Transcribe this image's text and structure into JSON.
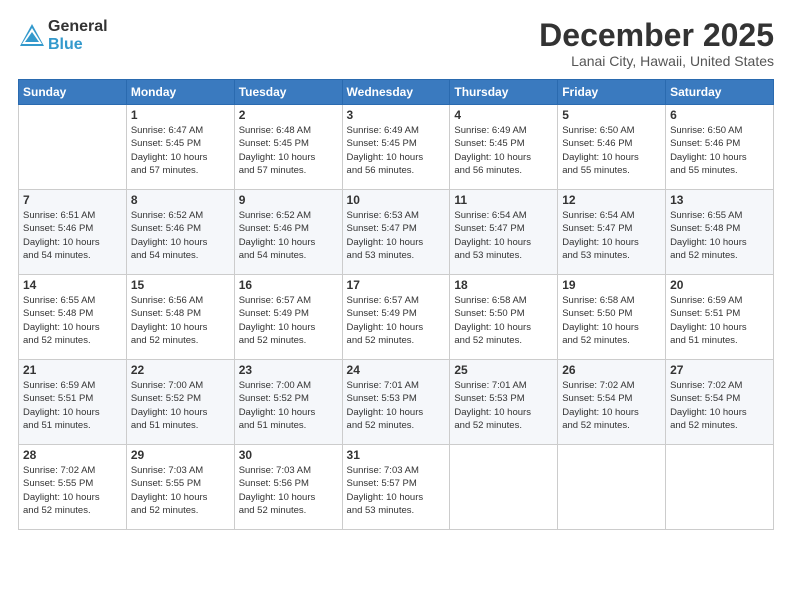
{
  "header": {
    "logo": {
      "general": "General",
      "blue": "Blue"
    },
    "title": "December 2025",
    "subtitle": "Lanai City, Hawaii, United States"
  },
  "calendar": {
    "days_of_week": [
      "Sunday",
      "Monday",
      "Tuesday",
      "Wednesday",
      "Thursday",
      "Friday",
      "Saturday"
    ],
    "weeks": [
      [
        {
          "day": "",
          "info": ""
        },
        {
          "day": "1",
          "info": "Sunrise: 6:47 AM\nSunset: 5:45 PM\nDaylight: 10 hours\nand 57 minutes."
        },
        {
          "day": "2",
          "info": "Sunrise: 6:48 AM\nSunset: 5:45 PM\nDaylight: 10 hours\nand 57 minutes."
        },
        {
          "day": "3",
          "info": "Sunrise: 6:49 AM\nSunset: 5:45 PM\nDaylight: 10 hours\nand 56 minutes."
        },
        {
          "day": "4",
          "info": "Sunrise: 6:49 AM\nSunset: 5:45 PM\nDaylight: 10 hours\nand 56 minutes."
        },
        {
          "day": "5",
          "info": "Sunrise: 6:50 AM\nSunset: 5:46 PM\nDaylight: 10 hours\nand 55 minutes."
        },
        {
          "day": "6",
          "info": "Sunrise: 6:50 AM\nSunset: 5:46 PM\nDaylight: 10 hours\nand 55 minutes."
        }
      ],
      [
        {
          "day": "7",
          "info": "Sunrise: 6:51 AM\nSunset: 5:46 PM\nDaylight: 10 hours\nand 54 minutes."
        },
        {
          "day": "8",
          "info": "Sunrise: 6:52 AM\nSunset: 5:46 PM\nDaylight: 10 hours\nand 54 minutes."
        },
        {
          "day": "9",
          "info": "Sunrise: 6:52 AM\nSunset: 5:46 PM\nDaylight: 10 hours\nand 54 minutes."
        },
        {
          "day": "10",
          "info": "Sunrise: 6:53 AM\nSunset: 5:47 PM\nDaylight: 10 hours\nand 53 minutes."
        },
        {
          "day": "11",
          "info": "Sunrise: 6:54 AM\nSunset: 5:47 PM\nDaylight: 10 hours\nand 53 minutes."
        },
        {
          "day": "12",
          "info": "Sunrise: 6:54 AM\nSunset: 5:47 PM\nDaylight: 10 hours\nand 53 minutes."
        },
        {
          "day": "13",
          "info": "Sunrise: 6:55 AM\nSunset: 5:48 PM\nDaylight: 10 hours\nand 52 minutes."
        }
      ],
      [
        {
          "day": "14",
          "info": "Sunrise: 6:55 AM\nSunset: 5:48 PM\nDaylight: 10 hours\nand 52 minutes."
        },
        {
          "day": "15",
          "info": "Sunrise: 6:56 AM\nSunset: 5:48 PM\nDaylight: 10 hours\nand 52 minutes."
        },
        {
          "day": "16",
          "info": "Sunrise: 6:57 AM\nSunset: 5:49 PM\nDaylight: 10 hours\nand 52 minutes."
        },
        {
          "day": "17",
          "info": "Sunrise: 6:57 AM\nSunset: 5:49 PM\nDaylight: 10 hours\nand 52 minutes."
        },
        {
          "day": "18",
          "info": "Sunrise: 6:58 AM\nSunset: 5:50 PM\nDaylight: 10 hours\nand 52 minutes."
        },
        {
          "day": "19",
          "info": "Sunrise: 6:58 AM\nSunset: 5:50 PM\nDaylight: 10 hours\nand 52 minutes."
        },
        {
          "day": "20",
          "info": "Sunrise: 6:59 AM\nSunset: 5:51 PM\nDaylight: 10 hours\nand 51 minutes."
        }
      ],
      [
        {
          "day": "21",
          "info": "Sunrise: 6:59 AM\nSunset: 5:51 PM\nDaylight: 10 hours\nand 51 minutes."
        },
        {
          "day": "22",
          "info": "Sunrise: 7:00 AM\nSunset: 5:52 PM\nDaylight: 10 hours\nand 51 minutes."
        },
        {
          "day": "23",
          "info": "Sunrise: 7:00 AM\nSunset: 5:52 PM\nDaylight: 10 hours\nand 51 minutes."
        },
        {
          "day": "24",
          "info": "Sunrise: 7:01 AM\nSunset: 5:53 PM\nDaylight: 10 hours\nand 52 minutes."
        },
        {
          "day": "25",
          "info": "Sunrise: 7:01 AM\nSunset: 5:53 PM\nDaylight: 10 hours\nand 52 minutes."
        },
        {
          "day": "26",
          "info": "Sunrise: 7:02 AM\nSunset: 5:54 PM\nDaylight: 10 hours\nand 52 minutes."
        },
        {
          "day": "27",
          "info": "Sunrise: 7:02 AM\nSunset: 5:54 PM\nDaylight: 10 hours\nand 52 minutes."
        }
      ],
      [
        {
          "day": "28",
          "info": "Sunrise: 7:02 AM\nSunset: 5:55 PM\nDaylight: 10 hours\nand 52 minutes."
        },
        {
          "day": "29",
          "info": "Sunrise: 7:03 AM\nSunset: 5:55 PM\nDaylight: 10 hours\nand 52 minutes."
        },
        {
          "day": "30",
          "info": "Sunrise: 7:03 AM\nSunset: 5:56 PM\nDaylight: 10 hours\nand 52 minutes."
        },
        {
          "day": "31",
          "info": "Sunrise: 7:03 AM\nSunset: 5:57 PM\nDaylight: 10 hours\nand 53 minutes."
        },
        {
          "day": "",
          "info": ""
        },
        {
          "day": "",
          "info": ""
        },
        {
          "day": "",
          "info": ""
        }
      ]
    ]
  }
}
